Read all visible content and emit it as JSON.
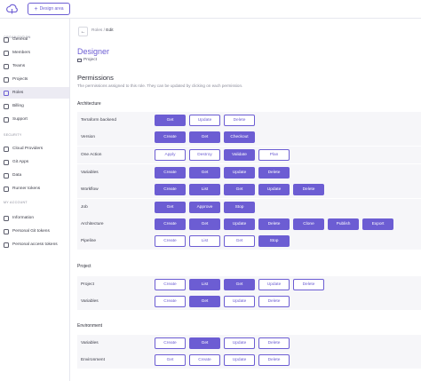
{
  "header": {
    "design_area_label": "Design area"
  },
  "sidebar": {
    "sections": [
      {
        "title": "Organization",
        "items": [
          {
            "label": "General",
            "icon": "home-icon"
          },
          {
            "label": "Members",
            "icon": "users-icon"
          },
          {
            "label": "Teams",
            "icon": "teams-icon"
          },
          {
            "label": "Projects",
            "icon": "projects-icon"
          },
          {
            "label": "Roles",
            "icon": "roles-icon",
            "active": true
          },
          {
            "label": "Billing",
            "icon": "billing-icon"
          },
          {
            "label": "Support",
            "icon": "support-icon"
          }
        ]
      },
      {
        "title": "Security",
        "items": [
          {
            "label": "Cloud Providers",
            "icon": "cloud-icon"
          },
          {
            "label": "Git Apps",
            "icon": "git-icon"
          },
          {
            "label": "Data",
            "icon": "data-icon"
          },
          {
            "label": "Runner tokens",
            "icon": "token-icon"
          }
        ]
      },
      {
        "title": "My account",
        "items": [
          {
            "label": "Information",
            "icon": "info-icon"
          },
          {
            "label": "Personal Git tokens",
            "icon": "key-icon"
          },
          {
            "label": "Personal access tokens",
            "icon": "key-icon"
          }
        ]
      }
    ]
  },
  "breadcrumb": {
    "parent": "Roles",
    "separator": " / ",
    "current": "Edit"
  },
  "role": {
    "name": "Designer",
    "type": "Project"
  },
  "permissions": {
    "title": "Permissions",
    "description": "The permissions assigned to this role. They can be updated by clicking on each permission."
  },
  "groups": [
    {
      "title": "Architecture",
      "rows": [
        {
          "label": "Terraform backend",
          "buttons": [
            {
              "label": "Get",
              "active": true
            },
            {
              "label": "Update",
              "active": false
            },
            {
              "label": "Delete",
              "active": false
            }
          ]
        },
        {
          "label": "Version",
          "buttons": [
            {
              "label": "Create",
              "active": true
            },
            {
              "label": "Get",
              "active": true
            },
            {
              "label": "Checkout",
              "active": true
            }
          ]
        },
        {
          "label": "One Action",
          "buttons": [
            {
              "label": "Apply",
              "active": false
            },
            {
              "label": "Destroy",
              "active": false
            },
            {
              "label": "Validate",
              "active": true
            },
            {
              "label": "Plan",
              "active": false
            }
          ]
        },
        {
          "label": "Variables",
          "buttons": [
            {
              "label": "Create",
              "active": true
            },
            {
              "label": "Get",
              "active": true
            },
            {
              "label": "Update",
              "active": true
            },
            {
              "label": "Delete",
              "active": true
            }
          ]
        },
        {
          "label": "Workflow",
          "buttons": [
            {
              "label": "Create",
              "active": true
            },
            {
              "label": "List",
              "active": true
            },
            {
              "label": "Get",
              "active": true
            },
            {
              "label": "Update",
              "active": true
            },
            {
              "label": "Delete",
              "active": true
            }
          ]
        },
        {
          "label": "Job",
          "buttons": [
            {
              "label": "Get",
              "active": true
            },
            {
              "label": "Approve",
              "active": true
            },
            {
              "label": "Stop",
              "active": true
            }
          ]
        },
        {
          "label": "Architecture",
          "buttons": [
            {
              "label": "Create",
              "active": true
            },
            {
              "label": "Get",
              "active": true
            },
            {
              "label": "Update",
              "active": true
            },
            {
              "label": "Delete",
              "active": true
            },
            {
              "label": "Clone",
              "active": true
            },
            {
              "label": "Publish",
              "active": true
            },
            {
              "label": "Export",
              "active": true
            }
          ]
        },
        {
          "label": "Pipeline",
          "buttons": [
            {
              "label": "Create",
              "active": false
            },
            {
              "label": "List",
              "active": false
            },
            {
              "label": "Get",
              "active": false
            },
            {
              "label": "Stop",
              "active": true
            }
          ]
        }
      ]
    },
    {
      "title": "Project",
      "rows": [
        {
          "label": "Project",
          "buttons": [
            {
              "label": "Create",
              "active": false
            },
            {
              "label": "List",
              "active": true
            },
            {
              "label": "Get",
              "active": true
            },
            {
              "label": "Update",
              "active": false
            },
            {
              "label": "Delete",
              "active": false
            }
          ]
        },
        {
          "label": "Variables",
          "buttons": [
            {
              "label": "Create",
              "active": false
            },
            {
              "label": "Get",
              "active": true
            },
            {
              "label": "Update",
              "active": false
            },
            {
              "label": "Delete",
              "active": false
            }
          ]
        }
      ]
    },
    {
      "title": "Environment",
      "rows": [
        {
          "label": "Variables",
          "buttons": [
            {
              "label": "Create",
              "active": false
            },
            {
              "label": "Get",
              "active": true
            },
            {
              "label": "Update",
              "active": false
            },
            {
              "label": "Delete",
              "active": false
            }
          ]
        },
        {
          "label": "Environment",
          "buttons": [
            {
              "label": "Get",
              "active": false
            },
            {
              "label": "Create",
              "active": false
            },
            {
              "label": "Update",
              "active": false
            },
            {
              "label": "Delete",
              "active": false
            }
          ]
        }
      ]
    }
  ],
  "colors": {
    "accent": "#6c5dd3",
    "row_bg": "#f6f6f9",
    "active_nav_bg": "#ecebf3"
  }
}
